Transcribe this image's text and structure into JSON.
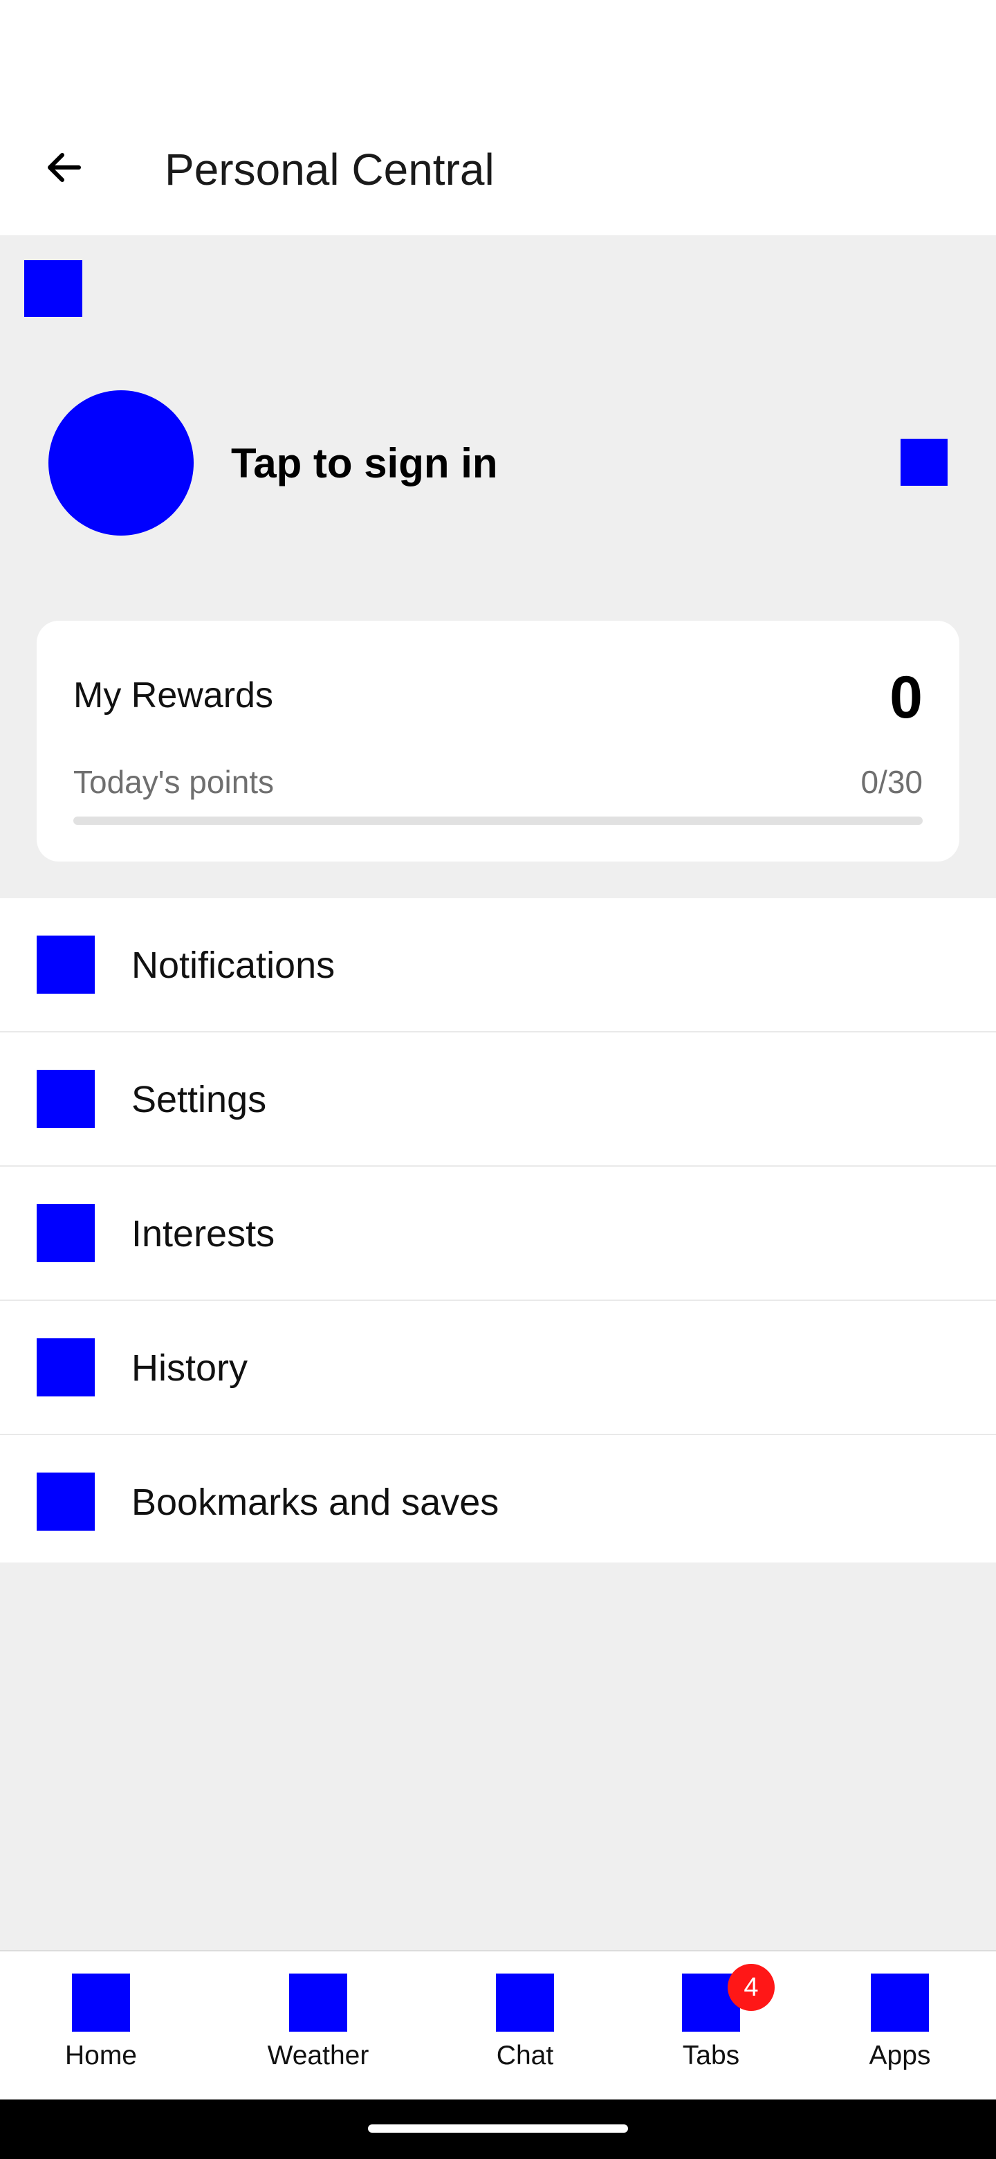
{
  "header": {
    "title": "Personal Central",
    "back_icon": "arrow-left-icon"
  },
  "profile": {
    "sign_in_text": "Tap to sign in",
    "avatar_icon": "avatar",
    "top_icon": "profile-badge-icon",
    "action_icon": "edit-profile-icon"
  },
  "rewards": {
    "title": "My Rewards",
    "value": "0",
    "points_label": "Today's points",
    "points_count": "0/30",
    "progress_fraction": 0
  },
  "menu": {
    "items": [
      {
        "label": "Notifications",
        "icon": "notifications-icon"
      },
      {
        "label": "Settings",
        "icon": "settings-icon"
      },
      {
        "label": "Interests",
        "icon": "interests-icon"
      },
      {
        "label": "History",
        "icon": "history-icon"
      },
      {
        "label": "Bookmarks and saves",
        "icon": "bookmarks-icon"
      }
    ]
  },
  "bottom_nav": {
    "items": [
      {
        "label": "Home",
        "icon": "home-icon"
      },
      {
        "label": "Weather",
        "icon": "weather-icon"
      },
      {
        "label": "Chat",
        "icon": "chat-icon"
      },
      {
        "label": "Tabs",
        "icon": "tabs-icon",
        "badge": "4"
      },
      {
        "label": "Apps",
        "icon": "apps-icon"
      }
    ]
  },
  "colors": {
    "placeholder": "#0000ff",
    "section_background": "#efefef",
    "badge": "#ff1717"
  }
}
